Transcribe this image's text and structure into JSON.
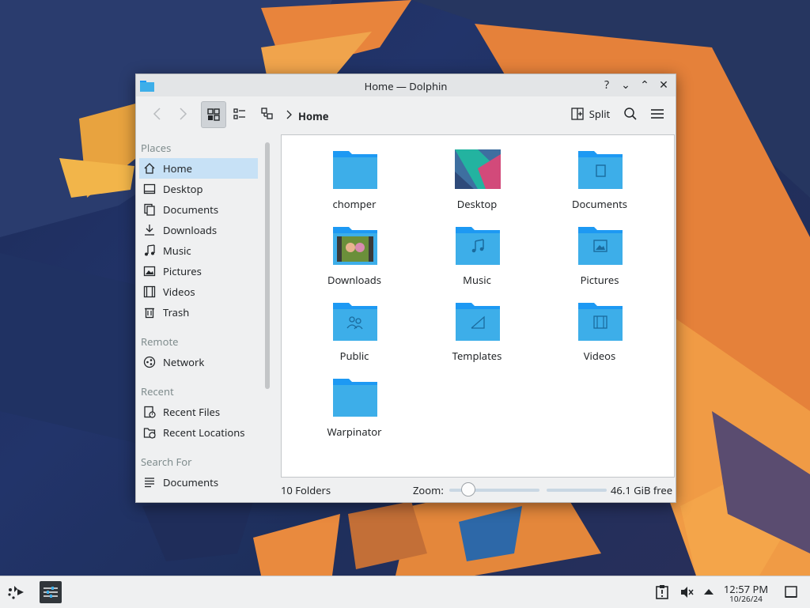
{
  "window": {
    "title": "Home — Dolphin"
  },
  "titlebar_buttons": {
    "help": "?",
    "minimize": "⌄",
    "maximize": "⌃",
    "close": "✕"
  },
  "toolbar": {
    "breadcrumb_current": "Home",
    "split_label": "Split"
  },
  "places": {
    "sections": [
      {
        "title": "Places",
        "items": [
          {
            "label": "Home",
            "icon": "home-icon",
            "selected": true
          },
          {
            "label": "Desktop",
            "icon": "desktop-icon"
          },
          {
            "label": "Documents",
            "icon": "documents-icon"
          },
          {
            "label": "Downloads",
            "icon": "downloads-icon"
          },
          {
            "label": "Music",
            "icon": "music-icon"
          },
          {
            "label": "Pictures",
            "icon": "pictures-icon"
          },
          {
            "label": "Videos",
            "icon": "videos-icon"
          },
          {
            "label": "Trash",
            "icon": "trash-icon"
          }
        ]
      },
      {
        "title": "Remote",
        "items": [
          {
            "label": "Network",
            "icon": "network-icon"
          }
        ]
      },
      {
        "title": "Recent",
        "items": [
          {
            "label": "Recent Files",
            "icon": "recent-files-icon"
          },
          {
            "label": "Recent Locations",
            "icon": "recent-locations-icon"
          }
        ]
      },
      {
        "title": "Search For",
        "items": [
          {
            "label": "Documents",
            "icon": "search-documents-icon"
          }
        ]
      }
    ]
  },
  "files": [
    {
      "name": "chomper",
      "icon": "folder-icon"
    },
    {
      "name": "Desktop",
      "icon": "desktop-wallpaper-icon"
    },
    {
      "name": "Documents",
      "icon": "folder-documents-icon"
    },
    {
      "name": "Downloads",
      "icon": "folder-downloads-thumbnail-icon"
    },
    {
      "name": "Music",
      "icon": "folder-music-icon"
    },
    {
      "name": "Pictures",
      "icon": "folder-pictures-icon"
    },
    {
      "name": "Public",
      "icon": "folder-public-icon"
    },
    {
      "name": "Templates",
      "icon": "folder-templates-icon"
    },
    {
      "name": "Videos",
      "icon": "folder-videos-icon"
    },
    {
      "name": "Warpinator",
      "icon": "folder-icon"
    }
  ],
  "statusbar": {
    "count": "10 Folders",
    "zoom_label": "Zoom:",
    "free_space": "46.1 GiB free",
    "zoom_fraction": 0.2
  },
  "panel": {
    "time": "12:57 PM",
    "date": "10/26/24"
  },
  "colors": {
    "folder": "#3daee9",
    "folder_tab": "#1d99f3",
    "selection": "#c7e1f6"
  }
}
